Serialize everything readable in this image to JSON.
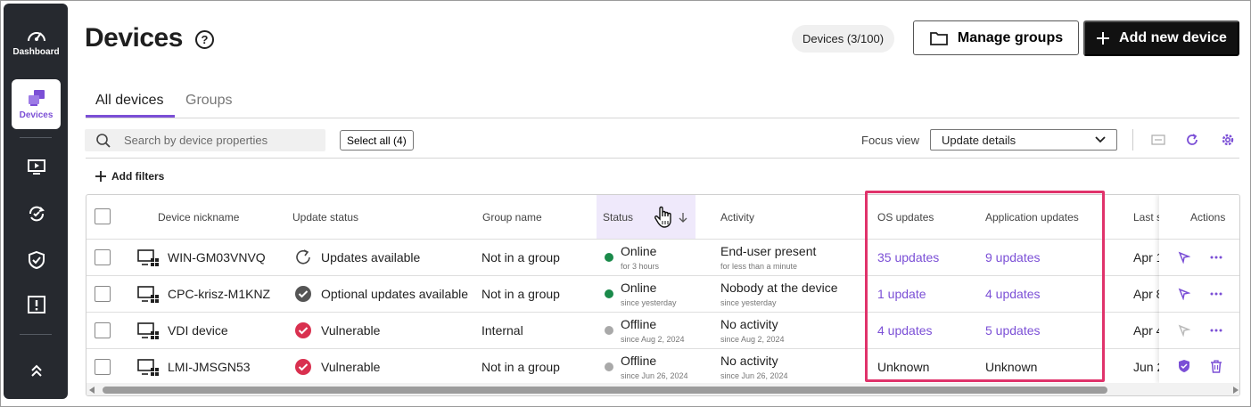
{
  "sidebar": {
    "items": [
      {
        "label": "Dashboard",
        "icon": "speedometer-icon"
      },
      {
        "label": "Devices",
        "icon": "devices-icon"
      },
      {
        "label": "",
        "icon": "monitor-play-icon"
      },
      {
        "label": "",
        "icon": "sync-check-icon"
      },
      {
        "label": "",
        "icon": "shield-check-icon"
      },
      {
        "label": "",
        "icon": "alert-icon"
      },
      {
        "label": "",
        "icon": "chevrons-up-icon"
      }
    ]
  },
  "header": {
    "title": "Devices",
    "help_glyph": "?",
    "device_count": "Devices (3/100)",
    "manage_groups": "Manage groups",
    "add_device": "Add new device"
  },
  "tabs": [
    {
      "label": "All devices",
      "active": true
    },
    {
      "label": "Groups",
      "active": false
    }
  ],
  "toolbar": {
    "search_placeholder": "Search by device properties",
    "select_all": "Select all (4)",
    "focus_label": "Focus view",
    "focus_value": "Update details",
    "add_filters": "Add filters"
  },
  "table": {
    "columns": [
      "Device nickname",
      "Update status",
      "Group name",
      "Status",
      "Activity",
      "OS updates",
      "Application updates",
      "Last s",
      "Actions"
    ],
    "rows": [
      {
        "name": "WIN-GM03VNVQ",
        "update_status": "Updates available",
        "update_icon": "refresh-icon",
        "group": "Not in a group",
        "status": "Online",
        "status_since": "for 3 hours",
        "status_color": "#1a8a4a",
        "activity": "End-user present",
        "activity_since": "for less than a minute",
        "os_updates": "35 updates",
        "app_updates": "9 updates",
        "last": "Apr 1",
        "linked": true
      },
      {
        "name": "CPC-krisz-M1KNZ",
        "update_status": "Optional updates available",
        "update_icon": "check-circle-icon",
        "group": "Not in a group",
        "status": "Online",
        "status_since": "since yesterday",
        "status_color": "#1a8a4a",
        "activity": "Nobody at the device",
        "activity_since": "since yesterday",
        "os_updates": "1 update",
        "app_updates": "4 updates",
        "last": "Apr 8",
        "linked": true
      },
      {
        "name": "VDI device",
        "update_status": "Vulnerable",
        "update_icon": "vulnerable-icon",
        "group": "Internal",
        "status": "Offline",
        "status_since": "since Aug 2, 2024",
        "status_color": "#a9a9a9",
        "activity": "No activity",
        "activity_since": "since Aug 2, 2024",
        "os_updates": "4 updates",
        "app_updates": "5 updates",
        "last": "Apr 4",
        "linked": true
      },
      {
        "name": "LMI-JMSGN53",
        "update_status": "Vulnerable",
        "update_icon": "vulnerable-icon",
        "group": "Not in a group",
        "status": "Offline",
        "status_since": "since Jun 26, 2024",
        "status_color": "#a9a9a9",
        "activity": "No activity",
        "activity_since": "since Jun 26, 2024",
        "os_updates": "Unknown",
        "app_updates": "Unknown",
        "last": "Jun 2",
        "linked": false
      }
    ]
  },
  "colors": {
    "accent": "#7b4fd6",
    "highlight": "#e0336b",
    "online": "#1a8a4a",
    "offline": "#a9a9a9",
    "vulnerable": "#d9304f"
  }
}
